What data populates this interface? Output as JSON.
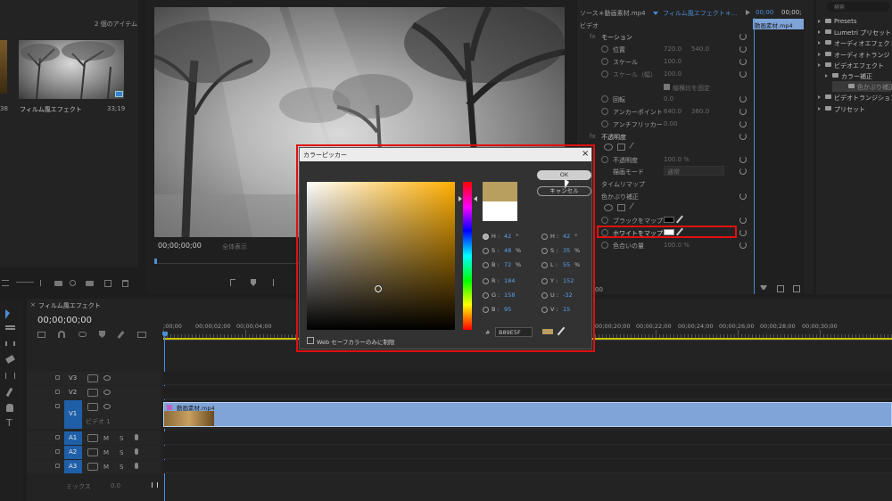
{
  "project": {
    "item_count": "2 個のアイテム",
    "clip_name": "フィルム風エフェクト",
    "clip_duration": "33;19",
    "left_num": "38"
  },
  "program": {
    "timecode": "00;00;00;00",
    "fit": "全体表示"
  },
  "effect_controls": {
    "source_tab": "ソース＊動画素材.mp4",
    "seq_tab": "フィルム風エフェクト＊...",
    "section_video": "ビデオ",
    "tc1": "00;00",
    "tc2": "00;00;",
    "clip_label": "動画素材.mp4",
    "motion": "モーション",
    "position": {
      "label": "位置",
      "v1": "720.0",
      "v2": "540.0"
    },
    "scale": {
      "label": "スケール",
      "value": "100.0"
    },
    "scale_w": {
      "label": "スケール（幅）",
      "value": "100.0"
    },
    "uniform": "縦横比を固定",
    "rotation": {
      "label": "回転",
      "value": "0.0"
    },
    "anchor": {
      "label": "アンカーポイント",
      "v1": "640.0",
      "v2": "360.0"
    },
    "antiflicker": {
      "label": "アンチフリッカー",
      "value": "0.00"
    },
    "opacity": "不透明度",
    "opacity_val": {
      "label": "不透明度",
      "value": "100.0 %"
    },
    "blend": {
      "label": "描画モード",
      "value": "通常"
    },
    "timeremap": "タイムリマップ",
    "tint": "色かぶり補正",
    "black_map": "ブラックをマップ",
    "white_map": "ホワイトをマップ",
    "amount": {
      "label": "色合いの量",
      "value": "100.0 %"
    },
    "bottom_tc": "00"
  },
  "effects_panel": {
    "search_placeholder": "検索",
    "items": [
      {
        "label": "Presets",
        "indent": 0
      },
      {
        "label": "Lumetri プリセット",
        "indent": 0
      },
      {
        "label": "オーディオエフェクト",
        "indent": 0
      },
      {
        "label": "オーディオトランジ",
        "indent": 0
      },
      {
        "label": "ビデオエフェクト",
        "indent": 0
      },
      {
        "label": "カラー補正",
        "indent": 1
      },
      {
        "label": "色かぶり補正",
        "indent": 2
      },
      {
        "label": "ビデオトランジション",
        "indent": 0
      },
      {
        "label": "プリセット",
        "indent": 0
      }
    ]
  },
  "timeline": {
    "tab": "フィルム風エフェクト",
    "timecode": "00;00;00;00",
    "ruler": [
      ";00;00",
      "00;00;02;00",
      "00;00;04;00",
      "00;00;20;00",
      "00;00;22;00",
      "00;00;24;00",
      "00;00;26;00",
      "00;00;28;00",
      "00;00;30;00"
    ],
    "tracks_video": [
      "V3",
      "V2",
      "V1"
    ],
    "tracks_audio": [
      "A1",
      "A2",
      "A3"
    ],
    "v1_name": "ビデオ 1",
    "mix_label": "ミックス",
    "mix_val": "0.0",
    "clip_label": "動画素材.mp4",
    "m": "M",
    "s": "S"
  },
  "color_picker": {
    "title": "カラーピッカー",
    "ok": "OK",
    "cancel": "キャンセル",
    "web_safe": "Web セーフカラーのみに制限",
    "hex_label": "#",
    "hex": "B89E5F",
    "current_color": "#B89E5F",
    "hue": 42,
    "hsb": [
      {
        "k": "H",
        "v": "42",
        "u": "°"
      },
      {
        "k": "S",
        "v": "48",
        "u": "%"
      },
      {
        "k": "B",
        "v": "72",
        "u": "%"
      }
    ],
    "rgb": [
      {
        "k": "R",
        "v": "184"
      },
      {
        "k": "G",
        "v": "158"
      },
      {
        "k": "B",
        "v": "95"
      }
    ],
    "hsl": [
      {
        "k": "H",
        "v": "42",
        "u": "°"
      },
      {
        "k": "S",
        "v": "35",
        "u": "%"
      },
      {
        "k": "L",
        "v": "55",
        "u": "%"
      }
    ],
    "yuv": [
      {
        "k": "Y",
        "v": "152"
      },
      {
        "k": "U",
        "v": "-32"
      },
      {
        "k": "V",
        "v": "15"
      }
    ]
  },
  "colors": {
    "accent": "#4a8fd6",
    "highlight": "#e01010",
    "track_blue": "#1f5fa8",
    "clip": "#7ea4d8"
  }
}
